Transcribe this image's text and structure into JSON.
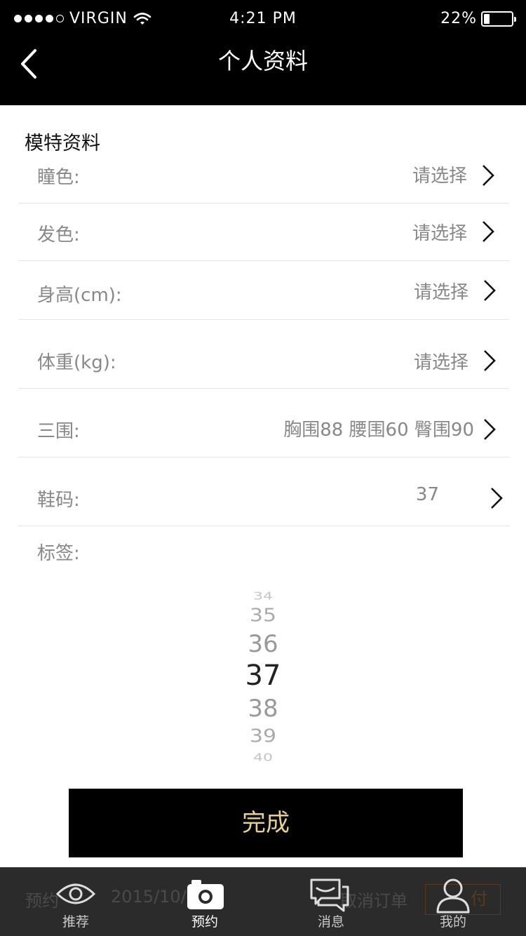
{
  "status_bar": {
    "carrier": "VIRGIN",
    "time": "4:21 PM",
    "battery": "22%",
    "battery_level": 0.22
  },
  "nav": {
    "title": "个人资料",
    "back_icon": "chevron-left-icon"
  },
  "section": {
    "title": "模特资料"
  },
  "rows": [
    {
      "label": "瞳色:",
      "value": "请选择"
    },
    {
      "label": "发色:",
      "value": "请选择"
    },
    {
      "label": "身高(cm):",
      "value": "请选择"
    },
    {
      "label": "体重(kg):",
      "value": "请选择"
    },
    {
      "label": "三围:",
      "value": "胸围88 腰围60 臀围90"
    },
    {
      "label": "鞋码:",
      "value": "37"
    }
  ],
  "tags": {
    "label": "标签:"
  },
  "picker": {
    "options": [
      "34",
      "35",
      "36",
      "37",
      "38",
      "39",
      "40"
    ],
    "selected": "37"
  },
  "done_button": {
    "label": "完成"
  },
  "background_order": {
    "prefix": "预约",
    "date": "2015/10/3",
    "cancel": "取消订单",
    "pay": "付"
  },
  "tabbar": {
    "tabs": [
      {
        "label": "推荐",
        "icon": "eye-icon"
      },
      {
        "label": "预约",
        "icon": "camera-icon",
        "active": true
      },
      {
        "label": "消息",
        "icon": "chat-icon"
      },
      {
        "label": "我的",
        "icon": "user-icon"
      }
    ]
  },
  "colors": {
    "header_bg": "#000000",
    "done_text": "#e8cf8c",
    "tabbar_bg": "#2b2b2b"
  }
}
